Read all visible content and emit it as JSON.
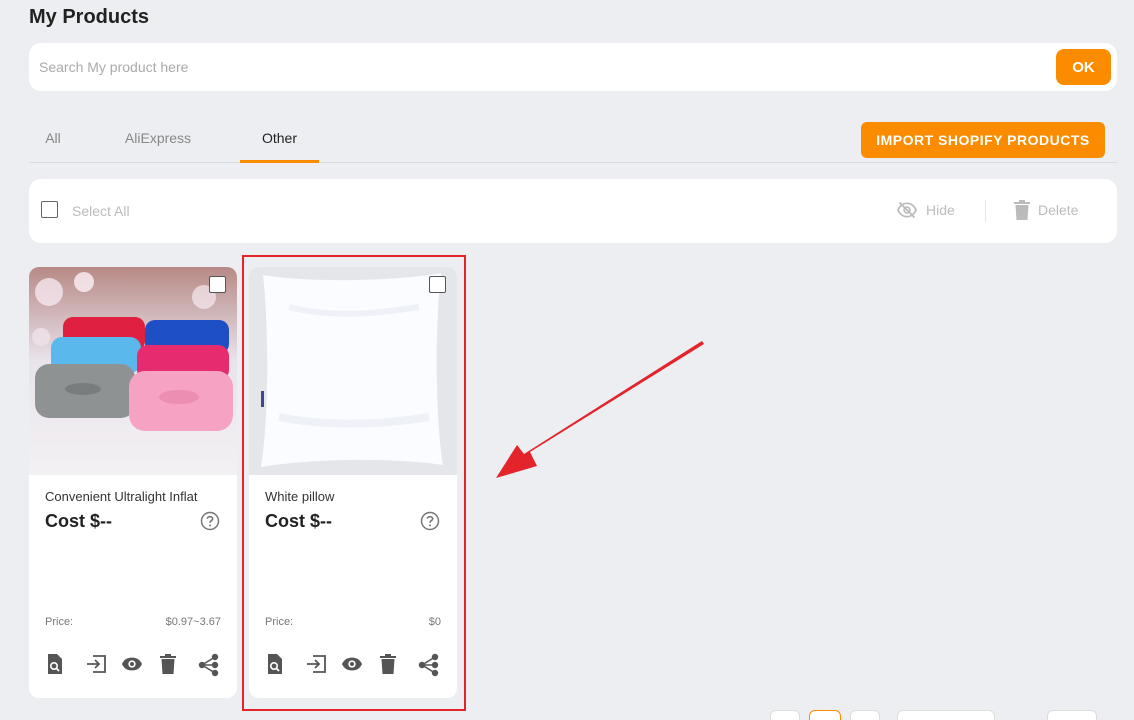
{
  "page": {
    "title": "My Products"
  },
  "search": {
    "placeholder": "Search My product here",
    "ok_label": "OK"
  },
  "tabs": [
    {
      "label": "All",
      "active": false
    },
    {
      "label": "AliExpress",
      "active": false
    },
    {
      "label": "Other",
      "active": true
    }
  ],
  "import_button": {
    "label": "IMPORT SHOPIFY PRODUCTS"
  },
  "toolbar": {
    "select_all_label": "Select All",
    "hide_label": "Hide",
    "delete_label": "Delete"
  },
  "products": [
    {
      "name": "Convenient Ultralight Inflat",
      "cost": "Cost $--",
      "price_label": "Price:",
      "price": "$0.97~3.67",
      "image": "inflatable-pillows-photo"
    },
    {
      "name": "White pillow",
      "cost": "Cost $--",
      "price_label": "Price:",
      "price": "$0",
      "image": "white-pillow-photo"
    }
  ],
  "colors": {
    "accent": "#fb8c00",
    "background": "#eceef1",
    "highlight": "#e3242b"
  },
  "icons": {
    "hide": "eye-off-icon",
    "delete": "trash-icon",
    "help": "question-circle-icon",
    "card_actions": [
      "document-search-icon",
      "import-icon",
      "eye-icon",
      "trash-icon",
      "share-icon"
    ]
  }
}
